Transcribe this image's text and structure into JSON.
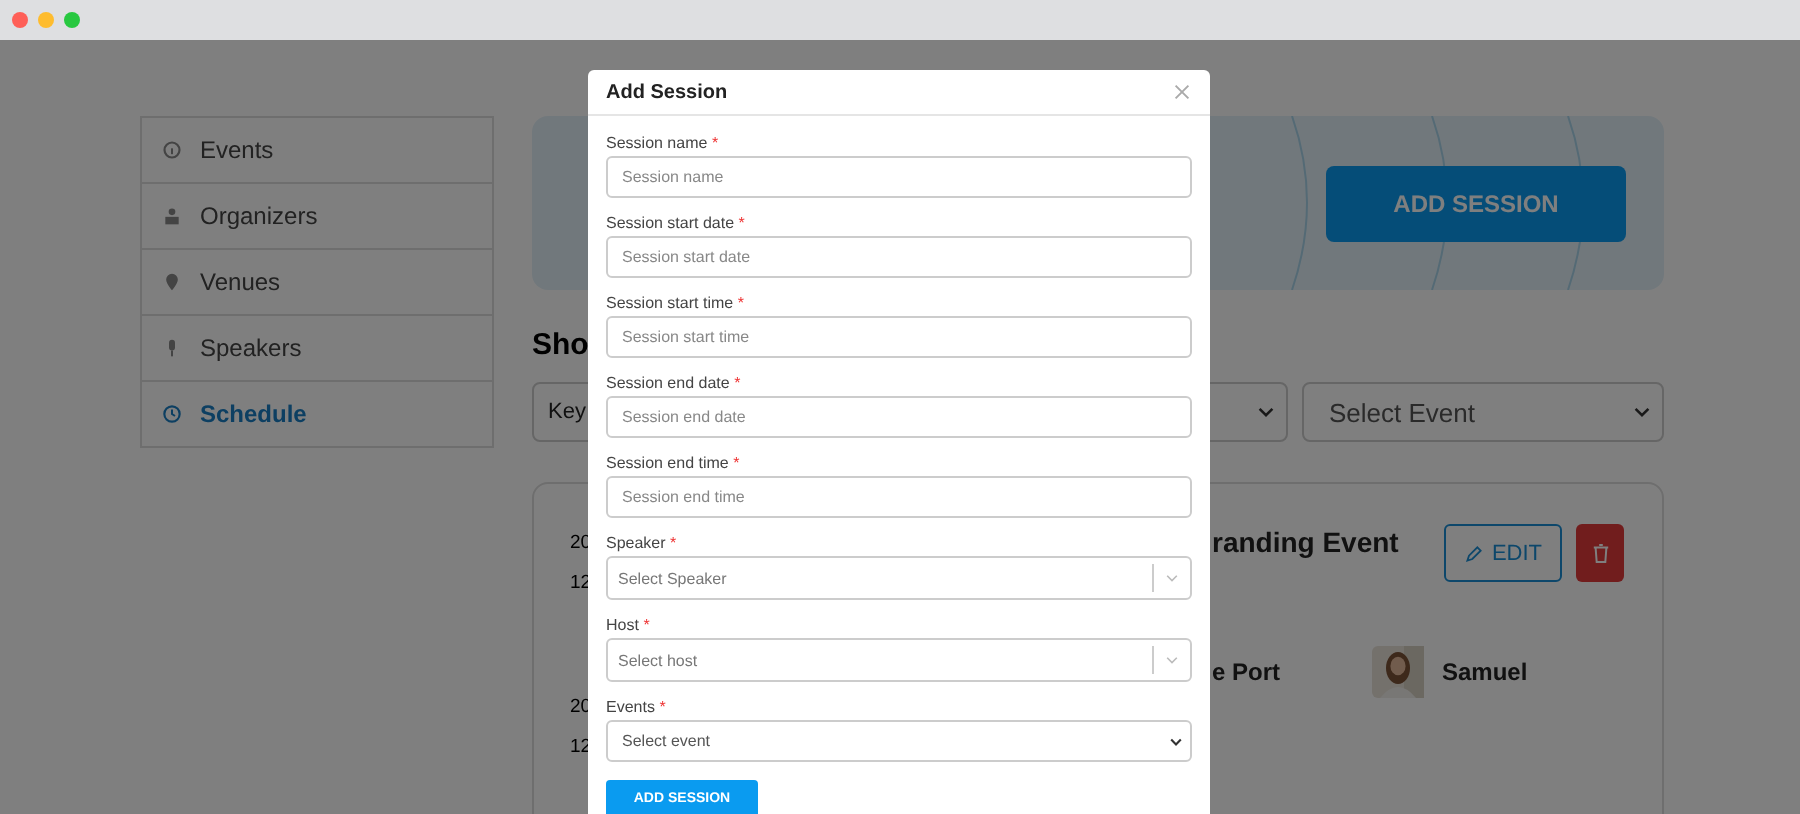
{
  "sidebar": {
    "items": [
      {
        "label": "Events",
        "selected": false
      },
      {
        "label": "Organizers",
        "selected": false
      },
      {
        "label": "Venues",
        "selected": false
      },
      {
        "label": "Speakers",
        "selected": false
      },
      {
        "label": "Schedule",
        "selected": true
      }
    ]
  },
  "banner": {
    "button": "ADD SESSION"
  },
  "heading": "Sho",
  "filters": {
    "keyword_placeholder": "Key",
    "event_select": "Select Event"
  },
  "schedule_card": {
    "title": "randing Event",
    "edit": "EDIT",
    "venue": "e Port",
    "speaker": "Samuel",
    "start": {
      "date": "20",
      "time": "12"
    },
    "end": {
      "date": "20",
      "time": "12"
    }
  },
  "modal": {
    "title": "Add Session",
    "fields": [
      {
        "label": "Session name",
        "required_mark": "*",
        "placeholder": "Session name",
        "kind": "input"
      },
      {
        "label": "Session start date",
        "required_mark": "*",
        "placeholder": "Session start date",
        "kind": "input"
      },
      {
        "label": "Session start time",
        "required_mark": "*",
        "placeholder": "Session start time",
        "kind": "input"
      },
      {
        "label": "Session end date",
        "required_mark": "*",
        "placeholder": "Session end date",
        "kind": "input"
      },
      {
        "label": "Session end time",
        "required_mark": "*",
        "placeholder": "Session end time",
        "kind": "input"
      },
      {
        "label": "Speaker",
        "required_mark": "*",
        "placeholder": "Select Speaker",
        "kind": "combo"
      },
      {
        "label": "Host",
        "required_mark": "*",
        "placeholder": "Select host",
        "kind": "combo"
      },
      {
        "label": "Events",
        "required_mark": "*",
        "placeholder": "Select event",
        "kind": "select"
      }
    ],
    "submit": "ADD SESSION"
  }
}
